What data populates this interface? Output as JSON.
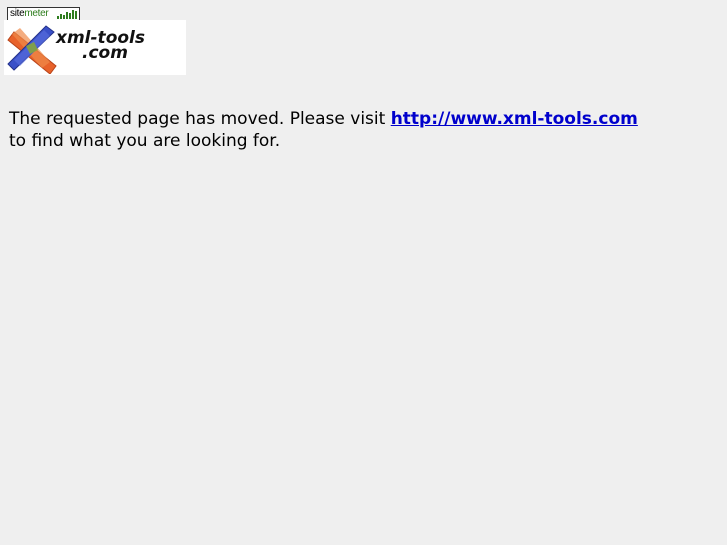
{
  "sitemeter": {
    "label_prefix": "site",
    "label_suffix": "meter"
  },
  "logo": {
    "line1": "xml-tools",
    "line2": ".com"
  },
  "message": {
    "before_link": "The requested page has moved. Please visit ",
    "link_text": "http://www.xml-tools.com",
    "after_link": "to find what you are looking for."
  },
  "colors": {
    "page_background": "#efefef",
    "link": "#0000cc"
  }
}
